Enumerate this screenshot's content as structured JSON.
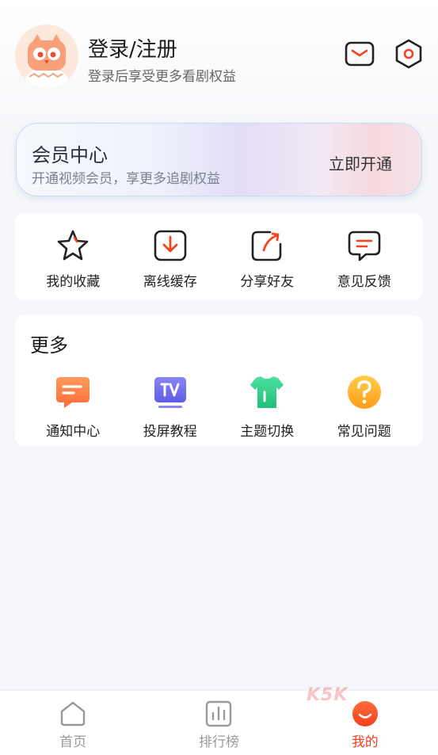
{
  "header": {
    "login_title": "登录/注册",
    "login_subtitle": "登录后享受更多看剧权益",
    "icons": [
      "mail-icon",
      "settings-icon"
    ]
  },
  "vip": {
    "title": "会员中心",
    "subtitle": "开通视频会员，享更多追剧权益",
    "action": "立即开通"
  },
  "quick_actions": [
    {
      "label": "我的收藏",
      "icon": "star-icon"
    },
    {
      "label": "离线缓存",
      "icon": "download-icon"
    },
    {
      "label": "分享好友",
      "icon": "share-icon"
    },
    {
      "label": "意见反馈",
      "icon": "feedback-icon"
    }
  ],
  "more": {
    "title": "更多",
    "items": [
      {
        "label": "通知中心",
        "icon": "notification-icon"
      },
      {
        "label": "投屏教程",
        "icon": "tv-cast-icon"
      },
      {
        "label": "主题切换",
        "icon": "theme-shirt-icon"
      },
      {
        "label": "常见问题",
        "icon": "question-icon"
      }
    ]
  },
  "tabbar": {
    "tabs": [
      {
        "label": "首页",
        "icon": "home-icon"
      },
      {
        "label": "排行榜",
        "icon": "ranking-icon"
      },
      {
        "label": "我的",
        "icon": "profile-icon",
        "active": true
      }
    ]
  },
  "watermark": "K5K",
  "colors": {
    "accent": "#f5421f",
    "text": "#222222",
    "muted": "#9a9a9a"
  }
}
